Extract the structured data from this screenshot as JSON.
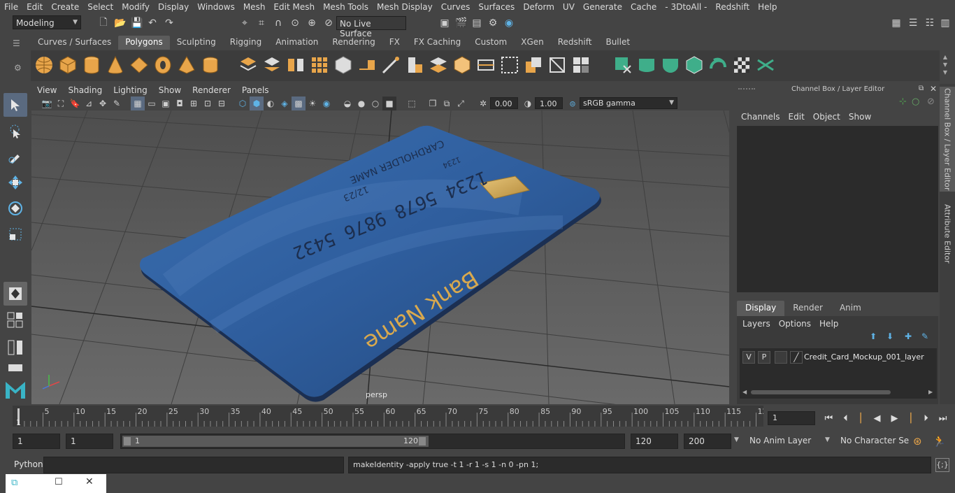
{
  "menubar": [
    "File",
    "Edit",
    "Create",
    "Select",
    "Modify",
    "Display",
    "Windows",
    "Mesh",
    "Edit Mesh",
    "Mesh Tools",
    "Mesh Display",
    "Curves",
    "Surfaces",
    "Deform",
    "UV",
    "Generate",
    "Cache",
    "- 3DtoAll -",
    "Redshift",
    "Help"
  ],
  "statusline": {
    "mode": "Modeling",
    "live_surface": "No Live Surface"
  },
  "shelf": {
    "tabs": [
      "Curves / Surfaces",
      "Polygons",
      "Sculpting",
      "Rigging",
      "Animation",
      "Rendering",
      "FX",
      "FX Caching",
      "Custom",
      "XGen",
      "Redshift",
      "Bullet"
    ],
    "active": "Polygons"
  },
  "viewport": {
    "menu": [
      "View",
      "Shading",
      "Lighting",
      "Show",
      "Renderer",
      "Panels"
    ],
    "exposure": "0.00",
    "gamma": "1.00",
    "colorspace": "sRGB gamma",
    "camera_label": "persp",
    "card": {
      "bank_name": "Bank Name",
      "number": "1234 5678 9876 5432",
      "small_number": "1234",
      "expiry": "12/23",
      "holder": "CARDHOLDER NAME"
    }
  },
  "channelbox": {
    "title": "Channel Box / Layer Editor",
    "menu": [
      "Channels",
      "Edit",
      "Object",
      "Show"
    ],
    "layer_tabs": [
      "Display",
      "Render",
      "Anim"
    ],
    "active_layer_tab": "Display",
    "layer_menu": [
      "Layers",
      "Options",
      "Help"
    ],
    "layer": {
      "v": "V",
      "p": "P",
      "name": "Credit_Card_Mockup_001_layer"
    }
  },
  "sidetabs": [
    "Channel Box / Layer Editor",
    "Attribute Editor"
  ],
  "timeslider": {
    "ticks": [
      "5",
      "10",
      "15",
      "20",
      "25",
      "30",
      "35",
      "40",
      "45",
      "50",
      "55",
      "60",
      "65",
      "70",
      "75",
      "80",
      "85",
      "90",
      "95",
      "100",
      "105",
      "110",
      "115",
      "12"
    ],
    "start_marker": "1",
    "current_frame": "1"
  },
  "range": {
    "start": "1",
    "playback_start": "1",
    "slider_start": "1",
    "slider_end": "120",
    "playback_end": "120",
    "end": "200",
    "anim_layer": "No Anim Layer",
    "character_set": "No Character Set"
  },
  "cmdline": {
    "language": "Python",
    "input": "",
    "output": "makeIdentity -apply true -t 1 -r 1 -s 1 -n 0 -pn 1;"
  },
  "colors": {
    "accent": "#5285a6",
    "card_blue": "#2f5e9e",
    "icon_orange": "#e8a54a",
    "icon_green": "#3fae8a"
  }
}
